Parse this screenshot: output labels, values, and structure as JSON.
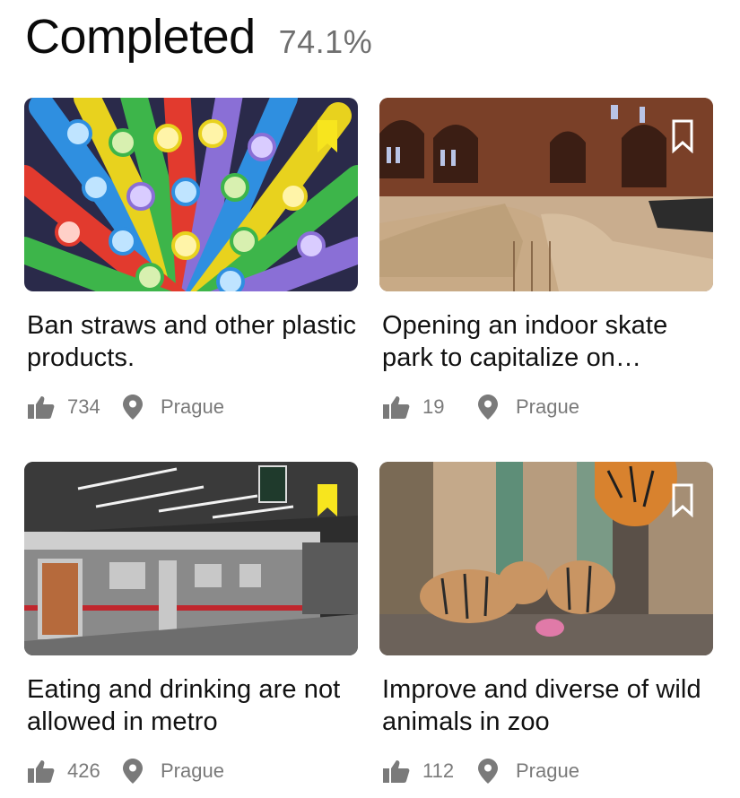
{
  "header": {
    "title": "Completed",
    "percent": "74.1%"
  },
  "colors": {
    "bookmark_saved": "#f7e51e",
    "bookmark_unsaved": "#ffffff",
    "meta_text": "#7a7a7a"
  },
  "cards": [
    {
      "caption": "Ban straws and other plastic products.",
      "likes": "734",
      "location": "Prague",
      "bookmarked": true,
      "image": "colorful-straws"
    },
    {
      "caption": "Opening an indoor skate park to capitalize on…",
      "likes": "19",
      "location": "Prague",
      "bookmarked": false,
      "image": "indoor-skate-park"
    },
    {
      "caption": "Eating and drinking are not allowed in metro",
      "likes": "426",
      "location": "Prague",
      "bookmarked": true,
      "image": "metro-station"
    },
    {
      "caption": "Improve and diverse of wild animals in zoo",
      "likes": "112",
      "location": "Prague",
      "bookmarked": false,
      "image": "tiger-cubs"
    }
  ]
}
